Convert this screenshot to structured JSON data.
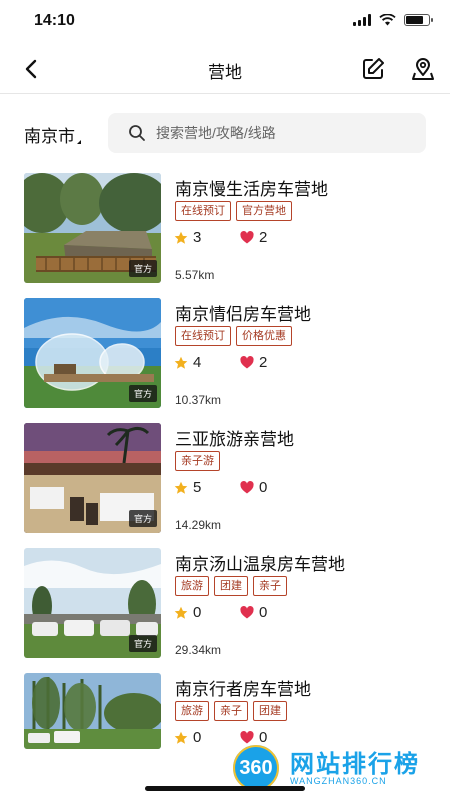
{
  "status_bar": {
    "time": "14:10"
  },
  "nav": {
    "title": "营地"
  },
  "city": {
    "label": "南京市"
  },
  "search": {
    "placeholder": "搜索营地/攻略/线路"
  },
  "colors": {
    "tag_border": "#b5442a",
    "star": "#f2b01e",
    "heart": "#e0304e"
  },
  "camps": [
    {
      "name": "南京慢生活房车营地",
      "tags": [
        "在线预订",
        "官方营地"
      ],
      "stars": "3",
      "likes": "2",
      "distance": "5.57km",
      "badge": "官方"
    },
    {
      "name": "南京情侣房车营地",
      "tags": [
        "在线预订",
        "价格优惠"
      ],
      "stars": "4",
      "likes": "2",
      "distance": "10.37km",
      "badge": "官方"
    },
    {
      "name": "三亚旅游亲营地",
      "tags": [
        "亲子游"
      ],
      "stars": "5",
      "likes": "0",
      "distance": "14.29km",
      "badge": "官方"
    },
    {
      "name": "南京汤山温泉房车营地",
      "tags": [
        "旅游",
        "团建",
        "亲子"
      ],
      "stars": "0",
      "likes": "0",
      "distance": "29.34km",
      "badge": "官方"
    },
    {
      "name": "南京行者房车营地",
      "tags": [
        "旅游",
        "亲子",
        "团建"
      ],
      "stars": "0",
      "likes": "0",
      "distance": "",
      "badge": ""
    }
  ],
  "watermark": {
    "logo_text": "360",
    "title": "网站排行榜",
    "subtitle": "WANGZHAN360.CN"
  }
}
